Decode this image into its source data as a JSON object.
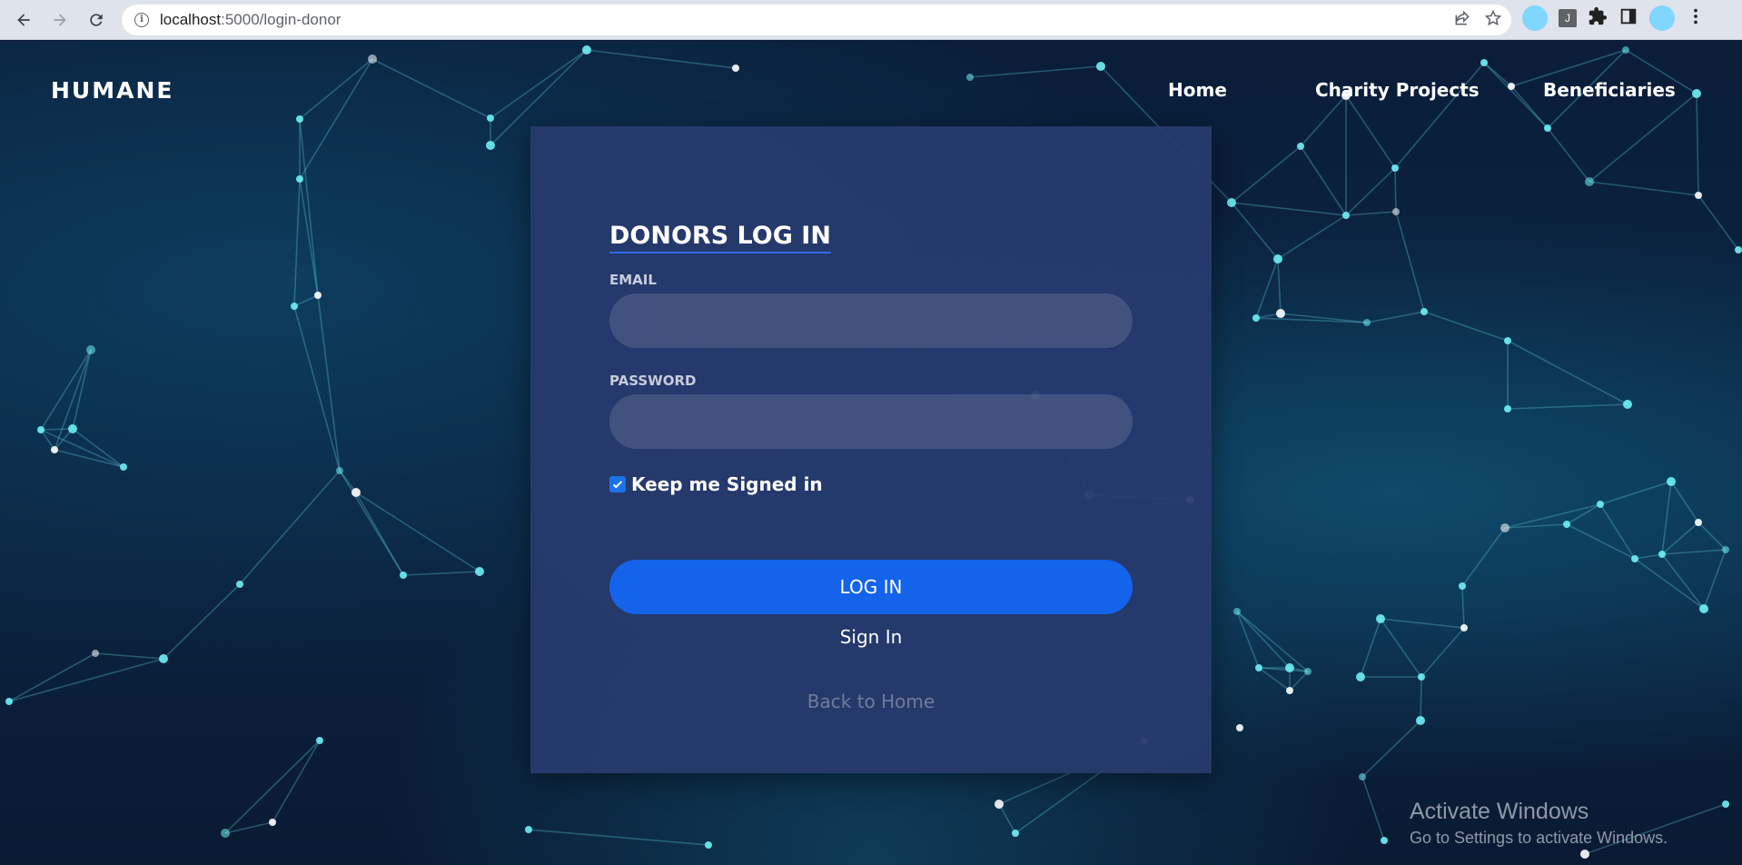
{
  "browser": {
    "url_host": "localhost",
    "url_path": ":5000/login-donor",
    "ext_letter": "J"
  },
  "site": {
    "brand": "HUMANE",
    "nav": [
      "Home",
      "Charity Projects",
      "Beneficiaries"
    ]
  },
  "login": {
    "title": "DONORS LOG IN",
    "email_label": "EMAIL",
    "email_value": "",
    "password_label": "PASSWORD",
    "password_value": "",
    "keep_signed_in_label": "Keep me Signed in",
    "keep_signed_in_checked": true,
    "login_button": "LOG IN",
    "signin_link": "Sign In",
    "back_link": "Back to Home"
  },
  "watermark": {
    "title": "Activate Windows",
    "subtitle": "Go to Settings to activate Windows."
  },
  "colors": {
    "accent": "#1463eb",
    "card_bg": "#283a6e",
    "page_bg": "#0b1a33"
  },
  "icons": [
    "back-arrow-icon",
    "forward-arrow-icon",
    "reload-icon",
    "info-icon",
    "share-icon",
    "star-icon",
    "puzzle-icon",
    "sidebar-icon",
    "kebab-menu-icon",
    "checkmark-icon"
  ]
}
